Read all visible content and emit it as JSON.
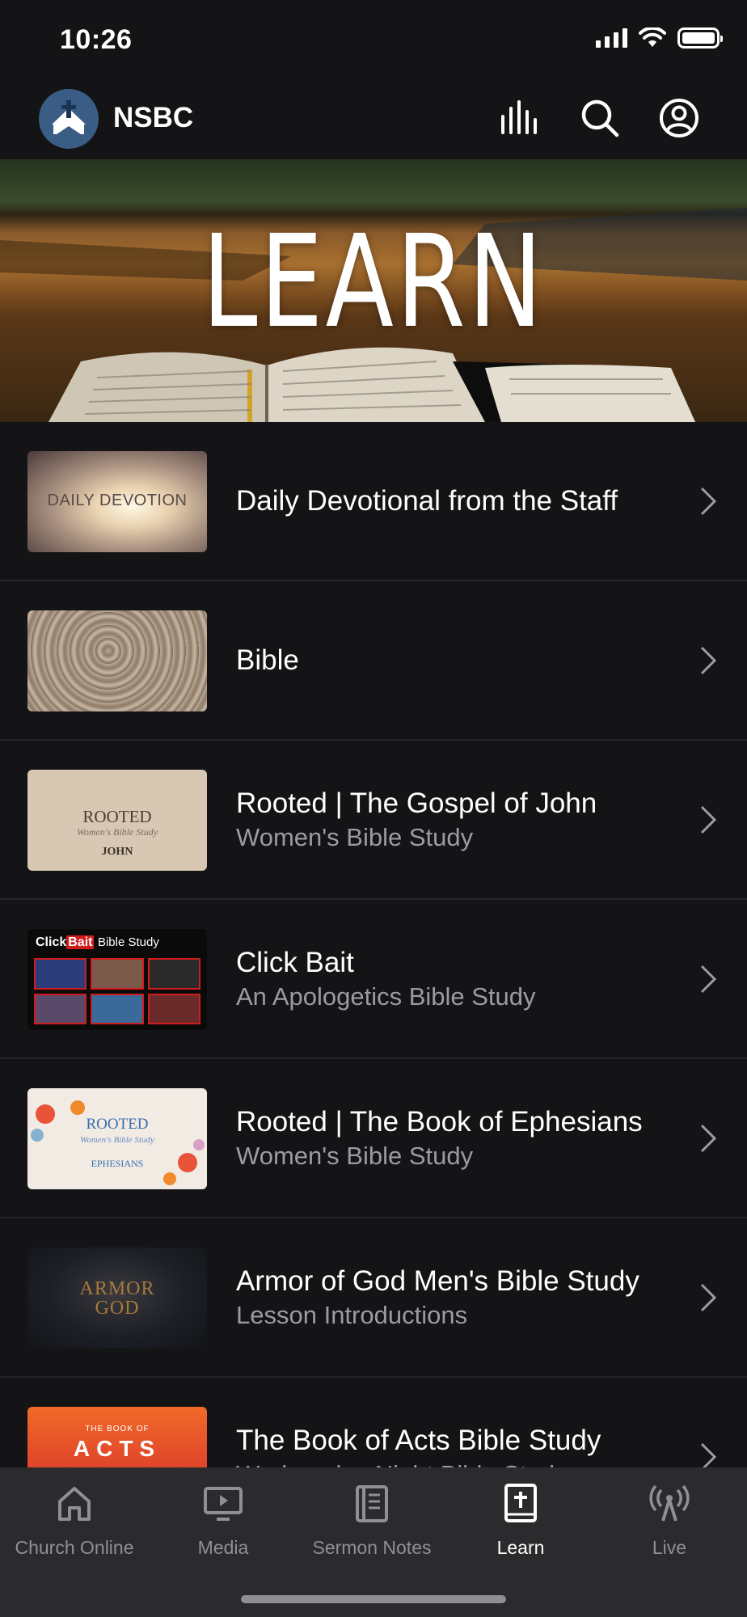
{
  "status_bar": {
    "time": "10:26"
  },
  "header": {
    "brand": "NSBC"
  },
  "hero": {
    "title": "LEARN"
  },
  "items": [
    {
      "title": "Daily Devotional from the Staff",
      "subtitle": "",
      "thumb_text": "DAILY DEVOTION"
    },
    {
      "title": "Bible",
      "subtitle": ""
    },
    {
      "title": "Rooted | The Gospel of John",
      "subtitle": "Women's Bible Study",
      "thumb_text": "ROOTED",
      "thumb_script": "Women's Bible Study",
      "thumb_sub": "JOHN"
    },
    {
      "title": "Click Bait",
      "subtitle": "An Apologetics Bible Study",
      "thumb_brand1": "Click",
      "thumb_brand2": "Bait",
      "thumb_text": "Bible Study"
    },
    {
      "title": "Rooted | The Book of Ephesians",
      "subtitle": "Women's Bible Study",
      "thumb_text": "ROOTED",
      "thumb_script": "Women's Bible Study",
      "thumb_sub": "EPHESIANS"
    },
    {
      "title": "Armor of God Men's Bible Study",
      "subtitle": "Lesson Introductions",
      "thumb_text": "ARMOR",
      "thumb_text2": "GOD"
    },
    {
      "title": "The Book of Acts Bible Study",
      "subtitle": "Wednesday Night Bible Study",
      "thumb_small": "THE BOOK OF",
      "thumb_text": "ACTS"
    }
  ],
  "tabs": [
    {
      "label": "Church Online",
      "icon": "home-icon",
      "active": false
    },
    {
      "label": "Media",
      "icon": "tv-play-icon",
      "active": false
    },
    {
      "label": "Sermon Notes",
      "icon": "notes-icon",
      "active": false
    },
    {
      "label": "Learn",
      "icon": "bible-icon",
      "active": true
    },
    {
      "label": "Live",
      "icon": "broadcast-icon",
      "active": false
    }
  ],
  "colors": {
    "background": "#141416",
    "tab_bar": "#2b2b2e",
    "subtitle": "#9b9ba1",
    "inactive_tab": "#8f8f94",
    "logo": "#3a5d86"
  }
}
